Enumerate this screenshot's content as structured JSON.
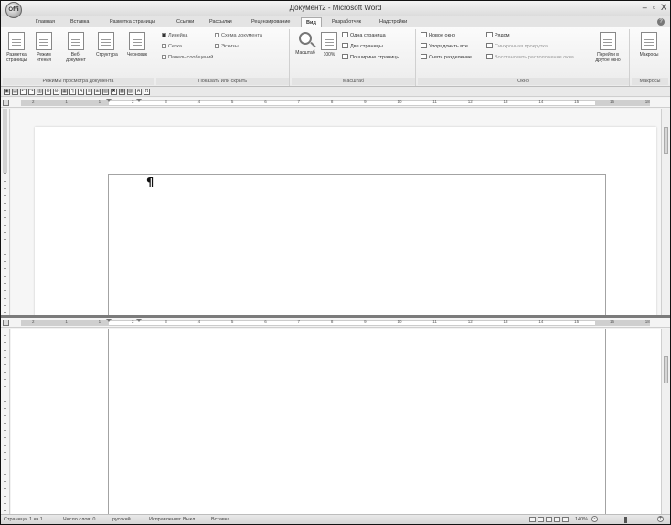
{
  "window": {
    "title": "Документ2 - Microsoft Word",
    "office_button": "Oﬃ",
    "controls": [
      "–",
      "▫",
      "X"
    ]
  },
  "tabs": [
    "Главная",
    "Вставка",
    "Разметка страницы",
    "Ссылки",
    "Рассылки",
    "Рецензирование",
    "Вид",
    "Разработчик",
    "Надстройки"
  ],
  "active_tab": "Вид",
  "ribbon": {
    "group_views": {
      "label": "Режимы просмотра документа",
      "buttons": [
        "Разметка страницы",
        "Режим чтения",
        "Веб-документ",
        "Структура",
        "Черновик"
      ]
    },
    "group_show": {
      "label": "Показать или скрыть",
      "checks": [
        {
          "label": "Линейка",
          "checked": true
        },
        {
          "label": "Сетка",
          "checked": false
        },
        {
          "label": "Панель сообщений",
          "checked": false
        },
        {
          "label": "Схема документа",
          "checked": false
        },
        {
          "label": "Эскизы",
          "checked": false
        }
      ]
    },
    "group_zoom": {
      "label": "Масштаб",
      "zoom_button": "Масштаб",
      "hundred_button": "100%",
      "options": [
        "Одна страница",
        "Две страницы",
        "По ширине страницы"
      ]
    },
    "group_window": {
      "label": "Окно",
      "col1": [
        "Новое окно",
        "Упорядочить все",
        "Снять разделение"
      ],
      "col2": [
        "Рядом",
        "Синхронная прокрутка",
        "Восстановить расположение окна"
      ],
      "switch_button": "Перейти в другое окно"
    },
    "group_macros": {
      "label": "Макросы",
      "button": "Макросы"
    }
  },
  "qat_symbols": [
    "▣",
    "▤",
    "↶",
    "↷",
    "▥",
    "⊕",
    "⊖",
    "▦",
    "¶",
    "A",
    "≡",
    "⊞",
    "▧",
    "✖",
    "▩",
    "▨",
    "A",
    "π"
  ],
  "ruler_numbers": [
    "2",
    "1",
    "1",
    "2",
    "3",
    "4",
    "5",
    "6",
    "7",
    "8",
    "9",
    "10",
    "11",
    "12",
    "13",
    "14",
    "15",
    "16",
    "18"
  ],
  "document": {
    "paragraph_mark": "¶"
  },
  "status_bar": {
    "page": "Страница: 1 из 1",
    "words": "Число слов: 0",
    "language": "русский",
    "track_changes": "Исправления: Выкл",
    "insert_mode": "Вставка",
    "zoom": "140%"
  }
}
